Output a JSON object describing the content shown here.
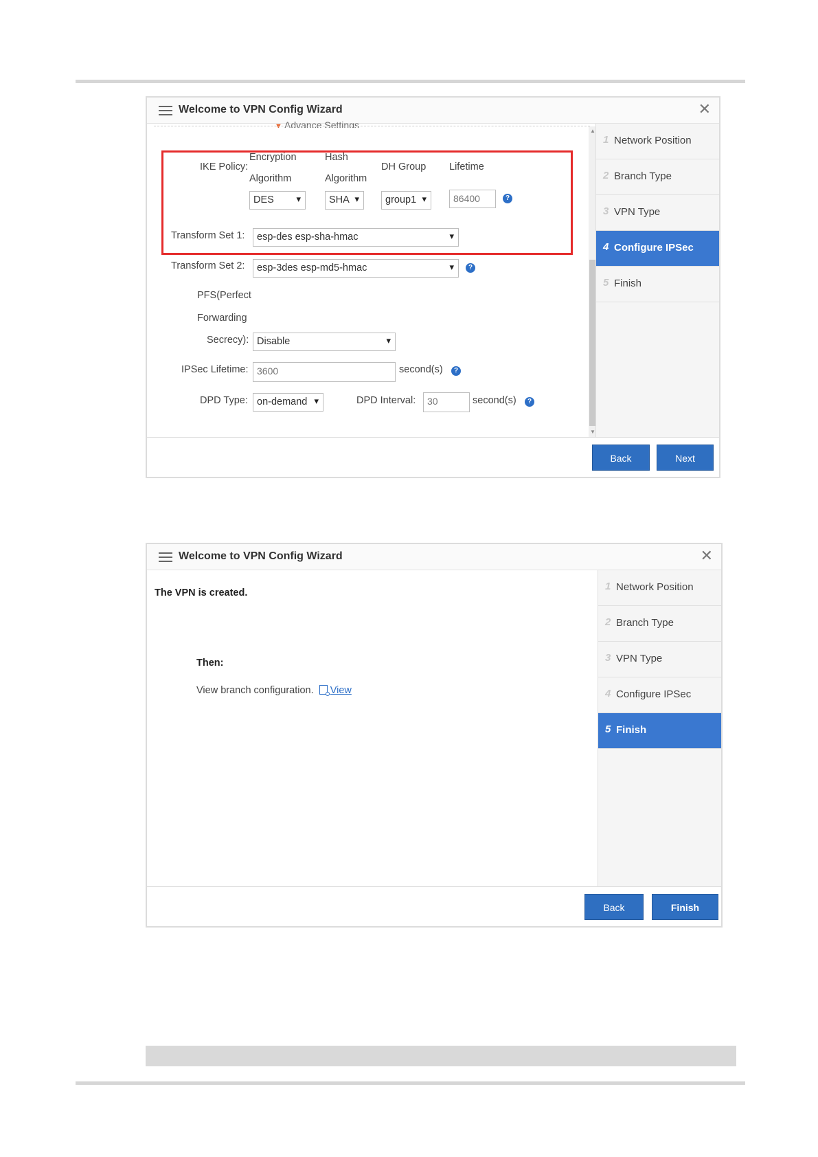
{
  "wizard1": {
    "title": "Welcome to VPN Config Wizard",
    "advance_label": "Advance Settings",
    "ike_policy_label": "IKE Policy:",
    "enc_header": [
      "Encryption",
      "Algorithm"
    ],
    "hash_header": [
      "Hash",
      "Algorithm"
    ],
    "dh_header": "DH Group",
    "lifetime_header": "Lifetime",
    "enc_value": "DES",
    "hash_value": "SHA",
    "dh_value": "group1",
    "lifetime_value": "86400",
    "ts1_label": "Transform Set 1:",
    "ts1_value": "esp-des esp-sha-hmac",
    "ts2_label": "Transform Set 2:",
    "ts2_value": "esp-3des esp-md5-hmac",
    "pfs_label": [
      "PFS(Perfect",
      "Forwarding",
      "Secrecy):"
    ],
    "pfs_value": "Disable",
    "ipsec_lifetime_label": "IPSec Lifetime:",
    "ipsec_lifetime_value": "3600",
    "seconds_label": "second(s)",
    "dpd_type_label": "DPD Type:",
    "dpd_type_value": "on-demand",
    "dpd_interval_label": "DPD Interval:",
    "dpd_interval_value": "30",
    "help_glyph": "?",
    "back_label": "Back",
    "next_label": "Next",
    "steps": [
      {
        "num": "1",
        "label": "Network Position"
      },
      {
        "num": "2",
        "label": "Branch Type"
      },
      {
        "num": "3",
        "label": "VPN Type"
      },
      {
        "num": "4",
        "label": "Configure IPSec",
        "active": true
      },
      {
        "num": "5",
        "label": "Finish"
      }
    ]
  },
  "wizard2": {
    "title": "Welcome to VPN Config Wizard",
    "created_msg": "The VPN is created.",
    "then_label": "Then:",
    "view_text": "View branch configuration.",
    "view_link": "View",
    "back_label": "Back",
    "finish_label": "Finish",
    "steps": [
      {
        "num": "1",
        "label": "Network Position"
      },
      {
        "num": "2",
        "label": "Branch Type"
      },
      {
        "num": "3",
        "label": "VPN Type"
      },
      {
        "num": "4",
        "label": "Configure IPSec"
      },
      {
        "num": "5",
        "label": "Finish",
        "active": true
      }
    ]
  },
  "colors": {
    "accent": "#2f6fc1",
    "highlight": "#e52b2b"
  },
  "icons": [
    "menu-icon",
    "close-icon",
    "help-icon",
    "view-doc-icon"
  ]
}
